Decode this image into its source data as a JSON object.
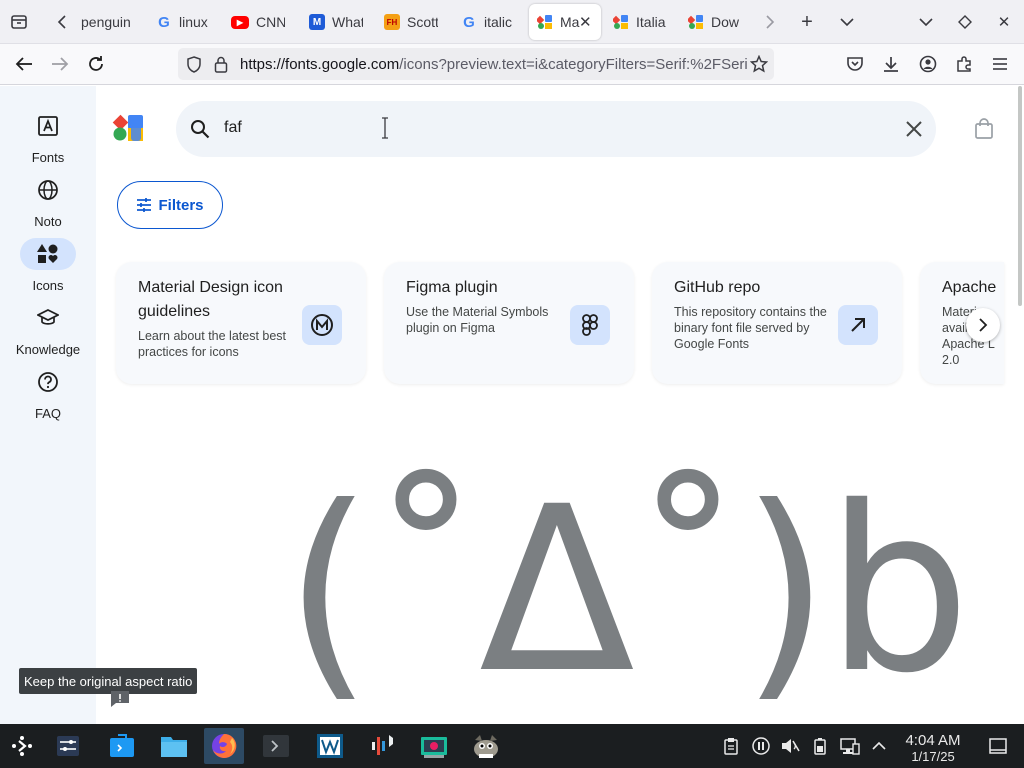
{
  "browser": {
    "tabs": [
      {
        "label": "penguin",
        "fav_text": "",
        "fav_color": ""
      },
      {
        "label": "linux",
        "fav_text": "G",
        "fav_color": "#4285f4"
      },
      {
        "label": "CNN",
        "fav_text": "▶",
        "fav_color": "#ff0000"
      },
      {
        "label": "What",
        "fav_text": "M",
        "fav_color": "#1e5bd7"
      },
      {
        "label": "Scott",
        "fav_text": "FH",
        "fav_color": "#f4a015"
      },
      {
        "label": "italic",
        "fav_text": "G",
        "fav_color": "#4285f4"
      },
      {
        "label": "Ma",
        "fav_text": "",
        "fav_color": ""
      },
      {
        "label": "Italia",
        "fav_text": "",
        "fav_color": ""
      },
      {
        "label": "Dow",
        "fav_text": "",
        "fav_color": ""
      }
    ],
    "url_domain": "https://fonts.google.com",
    "url_path": "/icons?preview.text=i&categoryFilters=Serif:%2FSeri"
  },
  "rail": {
    "items": [
      {
        "label": "Fonts"
      },
      {
        "label": "Noto"
      },
      {
        "label": "Icons"
      },
      {
        "label": "Knowledge"
      },
      {
        "label": "FAQ"
      }
    ]
  },
  "search": {
    "value": "faf"
  },
  "filters_label": "Filters",
  "cards": [
    {
      "title": "Material Design icon guidelines",
      "desc": "Learn about the latest best practices for icons"
    },
    {
      "title": "Figma plugin",
      "desc": "Use the Material Symbols plugin on Figma"
    },
    {
      "title": "GitHub repo",
      "desc": "This repository contains the binary font file served by Google Fonts"
    },
    {
      "title": "Apache",
      "desc": "Materi avail Apache L 2.0"
    }
  ],
  "preview_text": "(˚Δ˚)b",
  "tooltip": "Keep the original aspect ratio",
  "clock": {
    "time": "4:04 AM",
    "date": "1/17/25"
  },
  "colors": {
    "accent": "#0b57d0",
    "rail_bg": "#f2f6fb",
    "active_pill": "#d3e3fd"
  }
}
